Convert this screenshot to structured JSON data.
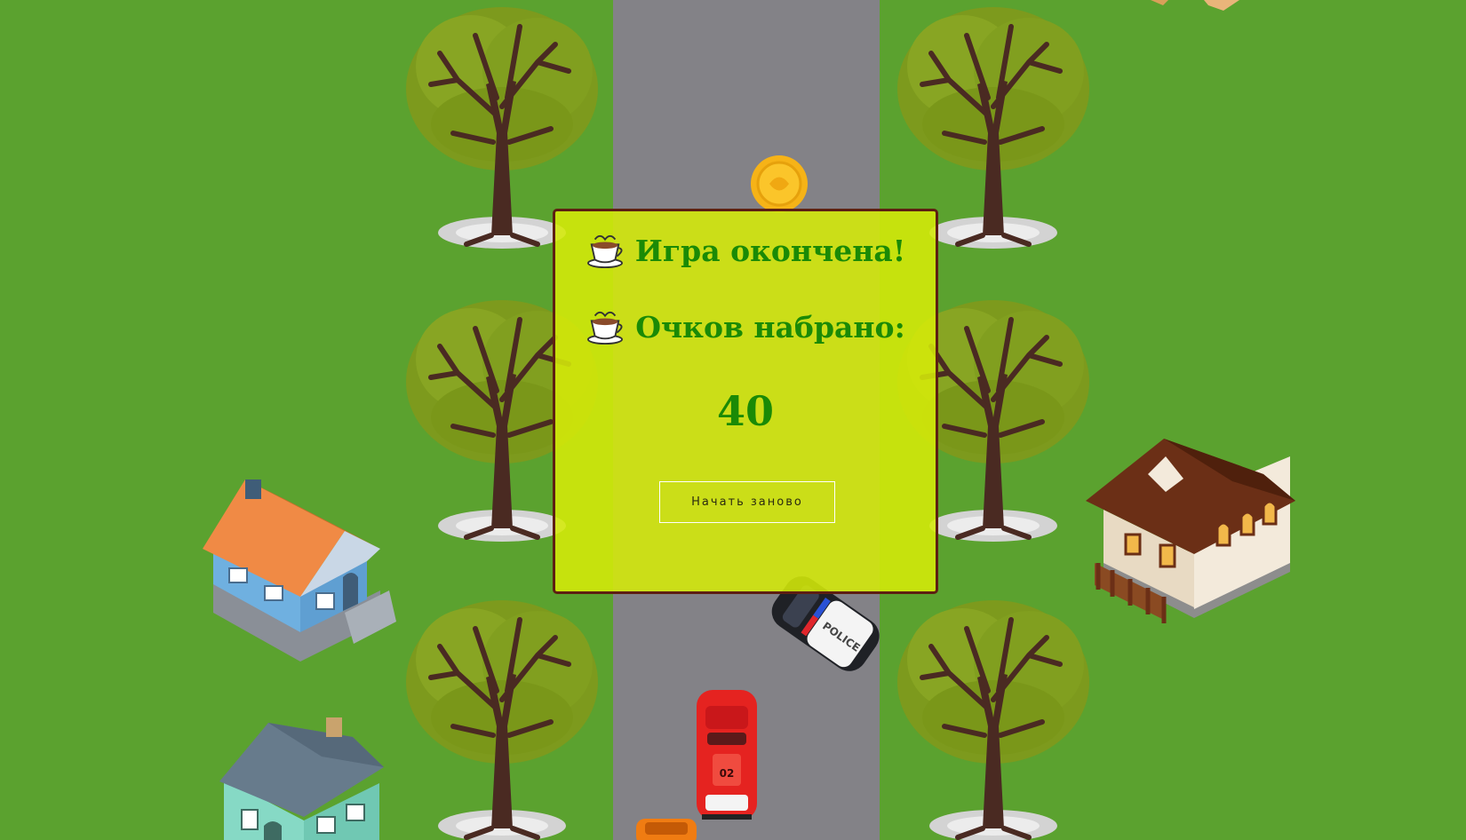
{
  "game_over": {
    "title": "Игра окончена!",
    "score_label": "Очков набрано:",
    "score": "40",
    "restart_button": "Начать заново",
    "icon": "coffee-cup-icon"
  },
  "scene": {
    "car_labels": {
      "police": "POLICE",
      "player_number": "02"
    }
  },
  "colors": {
    "grass": "#5ba22f",
    "road": "#838287",
    "overlay_bg": "#d5ea09",
    "overlay_border": "#5d1f12",
    "text_green": "#1a8a06"
  }
}
